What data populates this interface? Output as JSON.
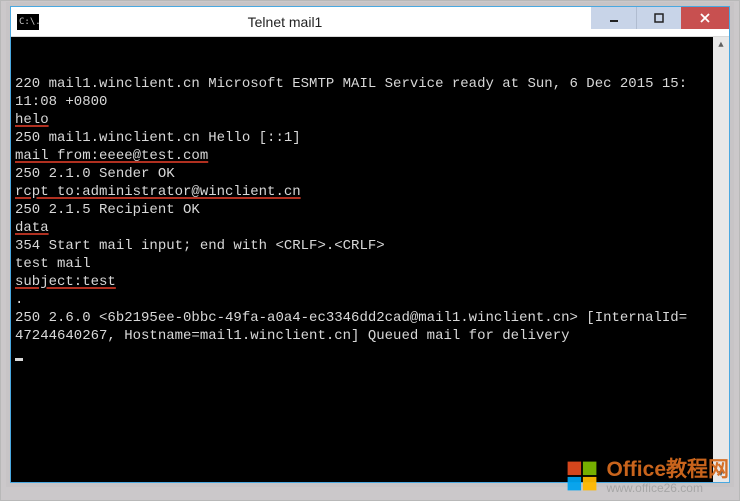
{
  "window": {
    "icon_text": "C:\\.",
    "title": "Telnet mail1",
    "controls": {
      "minimize_tooltip": "Minimize",
      "maximize_tooltip": "Maximize",
      "close_tooltip": "Close"
    }
  },
  "terminal": {
    "lines": [
      {
        "text": "220 mail1.winclient.cn Microsoft ESMTP MAIL Service ready at Sun, 6 Dec 2015 15:",
        "underline": false
      },
      {
        "text": "11:08 +0800",
        "underline": false
      },
      {
        "text": "helo",
        "underline": true
      },
      {
        "text": "250 mail1.winclient.cn Hello [::1]",
        "underline": false
      },
      {
        "text": "mail from:eeee@test.com",
        "underline": true
      },
      {
        "text": "250 2.1.0 Sender OK",
        "underline": false
      },
      {
        "text": "rcpt to:administrator@winclient.cn",
        "underline": true
      },
      {
        "text": "250 2.1.5 Recipient OK",
        "underline": false
      },
      {
        "text": "data",
        "underline": true
      },
      {
        "text": "354 Start mail input; end with <CRLF>.<CRLF>",
        "underline": false
      },
      {
        "text": "test mail",
        "underline": false
      },
      {
        "text": "subject:test",
        "underline": true
      },
      {
        "text": "",
        "underline": false
      },
      {
        "text": ".",
        "underline": false
      },
      {
        "text": "250 2.6.0 <6b2195ee-0bbc-49fa-a0a4-ec3346dd2cad@mail1.winclient.cn> [InternalId=",
        "underline": false
      },
      {
        "text": "47244640267, Hostname=mail1.winclient.cn] Queued mail for delivery",
        "underline": false
      }
    ]
  },
  "watermark": {
    "title": "Office教程网",
    "url": "www.office26.com",
    "logo_colors": {
      "tl": "#e14a1e",
      "tr": "#7db900",
      "bl": "#00a3ee",
      "br": "#ffb900"
    }
  }
}
